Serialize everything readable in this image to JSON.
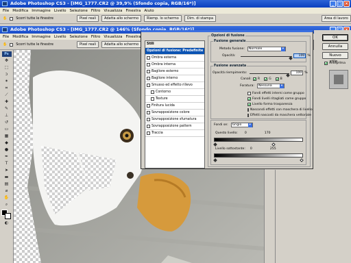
{
  "app": {
    "title_back": "Adobe Photoshop CS3 - [IMG_1777.CR2 @ 39,9% (Sfondo copia, RGB/16*)]",
    "title_front": "Adobe Photoshop CS3 - [IMG_1777.CR2 @ 146% (Sfondo copia, RGB/16*)]"
  },
  "menu": [
    "File",
    "Modifica",
    "Immagine",
    "Livello",
    "Selezione",
    "Filtro",
    "Visualizza",
    "Finestra",
    "Aiuto"
  ],
  "optionsbar": {
    "scroll_all": "Scorri tutte le finestre",
    "pixel_real": "Pixel reali",
    "fit_screen": "Adatta allo schermo",
    "full_screen": "Riemp. lo schermo",
    "print_dim": "Dim. di stampa",
    "workspace": "Area di lavoro"
  },
  "dialog": {
    "list_header": "Stili",
    "items": [
      {
        "label": "Opzioni di fusione: Predefinite",
        "selected": true,
        "checkbox": false,
        "indent": false
      },
      {
        "label": "Ombra esterna",
        "checkbox": true,
        "indent": false
      },
      {
        "label": "Ombra interna",
        "checkbox": true,
        "indent": false
      },
      {
        "label": "Bagliore esterno",
        "checkbox": true,
        "indent": false
      },
      {
        "label": "Bagliore interno",
        "checkbox": true,
        "indent": false
      },
      {
        "label": "Smusso ed effetto rilievo",
        "checkbox": true,
        "indent": false
      },
      {
        "label": "Contorno",
        "checkbox": true,
        "indent": true
      },
      {
        "label": "Texture",
        "checkbox": true,
        "indent": true
      },
      {
        "label": "Finitura lucida",
        "checkbox": true,
        "indent": false
      },
      {
        "label": "Sovrapposizione colore",
        "checkbox": true,
        "indent": false
      },
      {
        "label": "Sovrapposizione sfumatura",
        "checkbox": true,
        "indent": false
      },
      {
        "label": "Sovrapposizione pattern",
        "checkbox": true,
        "indent": false
      },
      {
        "label": "Traccia",
        "checkbox": true,
        "indent": false
      }
    ],
    "blend_options_title": "Opzioni di fusione",
    "general_title": "Fusione generale",
    "blend_mode_label": "Metodo fusione:",
    "blend_mode_value": "Normale",
    "opacity_label": "Opacità:",
    "opacity_value": "100",
    "opacity_unit": "%",
    "advanced_title": "Fusione avanzata",
    "fill_opacity_label": "Opacità riempimento:",
    "fill_opacity_value": "100",
    "fill_opacity_unit": "%",
    "channels_label": "Canali:",
    "channel_r": "R",
    "channel_g": "G",
    "channel_b": "B",
    "knockout_label": "Foratura:",
    "knockout_value": "Nessuna",
    "adv_checks": [
      {
        "label": "Fondi effetti interni come gruppo",
        "checked": false
      },
      {
        "label": "Fondi livelli ritagliati come gruppo",
        "checked": true
      },
      {
        "label": "Livello forma trasparenza",
        "checked": true
      },
      {
        "label": "Nascondi effetti con maschera di livello",
        "checked": false
      },
      {
        "label": "Effetti nascosti da maschera vettoriale",
        "checked": false
      }
    ],
    "blend_if_label": "Fondi se:",
    "blend_if_value": "Grigio",
    "this_layer_label": "Questo livello:",
    "this_layer_min": "0",
    "this_layer_max": "170",
    "underlying_label": "Livello sottostante:",
    "underlying_min": "0",
    "underlying_max": "255",
    "ok": "OK",
    "cancel": "Annulla",
    "new_style": "Nuovo stile...",
    "preview": "Anteprima"
  }
}
